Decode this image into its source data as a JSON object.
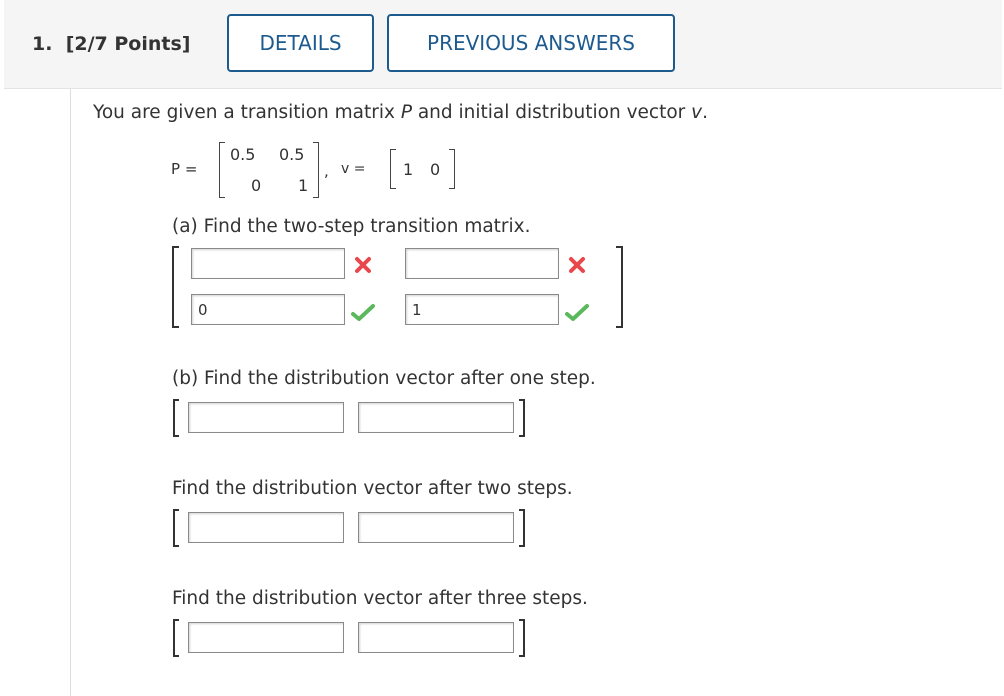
{
  "question": {
    "number_label": "1.",
    "points_label": "[2/7 Points]",
    "details_button": "DETAILS",
    "previous_answers_button": "PREVIOUS ANSWERS"
  },
  "prompt": {
    "intro_prefix": "You are given a transition matrix ",
    "intro_p": "P",
    "intro_mid": " and initial distribution vector ",
    "intro_v": "v",
    "intro_suffix": "."
  },
  "matrix_p": {
    "label": "P =",
    "rows": [
      [
        "0.5",
        "0.5"
      ],
      [
        "0",
        "1"
      ]
    ],
    "separator": ",",
    "v_label": "v =",
    "v_values": [
      "1",
      "0"
    ]
  },
  "part_a": {
    "prompt": "(a) Find the two-step transition matrix.",
    "cells": [
      {
        "value": "",
        "status": "incorrect"
      },
      {
        "value": "",
        "status": "incorrect"
      },
      {
        "value": "0",
        "status": "correct"
      },
      {
        "value": "1",
        "status": "correct"
      }
    ]
  },
  "part_b": {
    "prompt": "(b) Find the distribution vector after one step.",
    "values": [
      "",
      ""
    ]
  },
  "part_c": {
    "prompt": "Find the distribution vector after two steps.",
    "values": [
      "",
      ""
    ]
  },
  "part_d": {
    "prompt": "Find the distribution vector after three steps.",
    "values": [
      "",
      ""
    ]
  },
  "colors": {
    "accent": "#1d5a8e",
    "correct": "#5cb85c",
    "incorrect": "#e8474b"
  },
  "icons": {
    "correct": "check-icon",
    "incorrect": "cross-icon"
  }
}
